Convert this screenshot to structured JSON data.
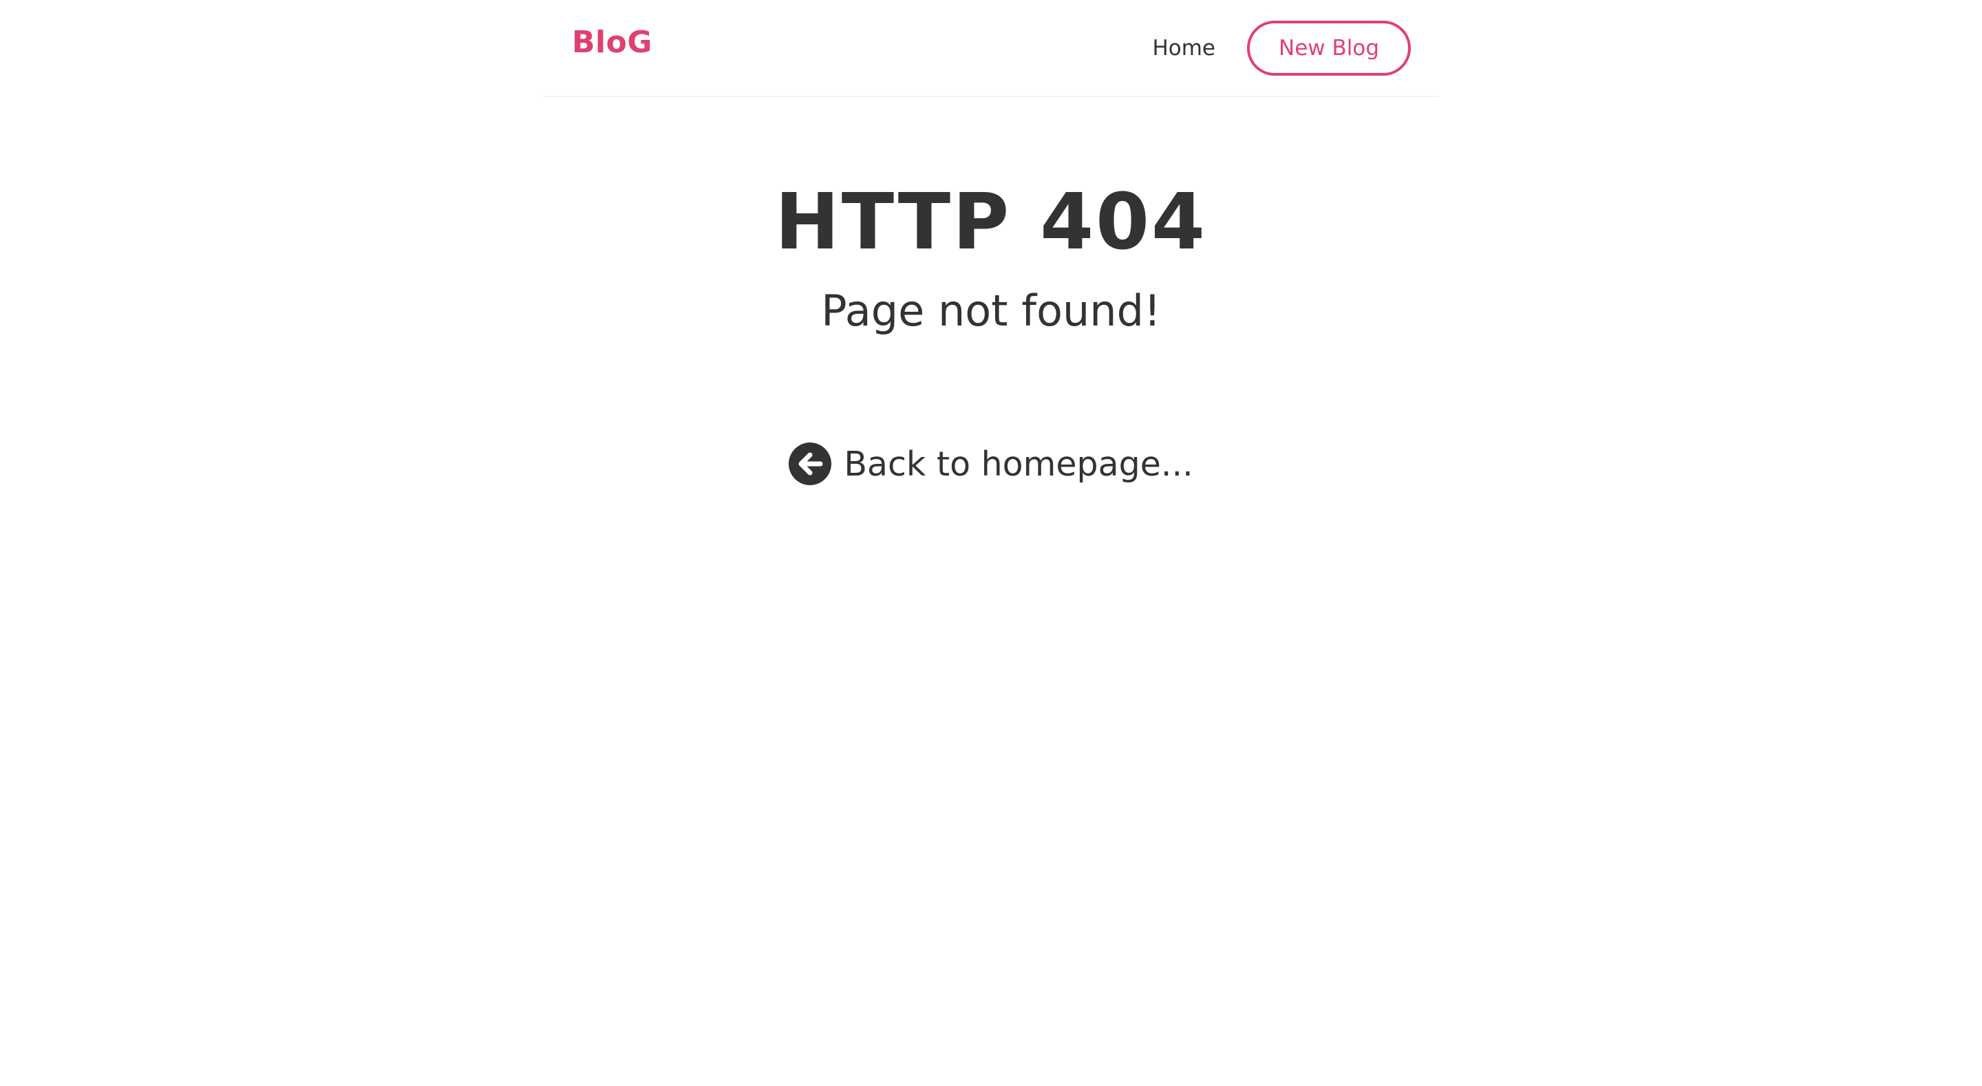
{
  "navbar": {
    "brand": "BloG",
    "home_label": "Home",
    "new_blog_label": "New Blog"
  },
  "error": {
    "title": "HTTP 404",
    "message": "Page not found!",
    "back_link_label": "Back to homepage..."
  },
  "icons": {
    "back": "arrow-left-circle-icon"
  },
  "colors": {
    "accent": "#e0406f",
    "text": "#333333",
    "background": "#ffffff"
  }
}
